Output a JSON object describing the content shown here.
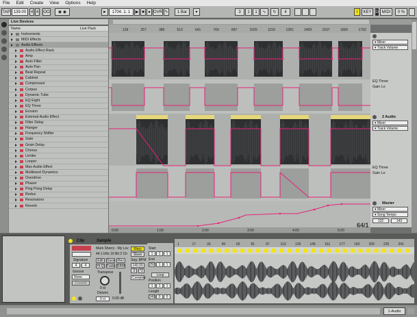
{
  "menu": {
    "file": "File",
    "edit": "Edit",
    "create": "Create",
    "view": "View",
    "options": "Options",
    "help": "Help"
  },
  "transport": {
    "tap": "TAP",
    "tempo": "139.00",
    "sig_num": "4",
    "sig_den": "4",
    "oo": "OO",
    "position": "1704. 1. 1",
    "ovr": "OVR",
    "quantize": "1 Bar",
    "loop_start": "3",
    "loop_beat": "1",
    "loop_sixteenth": "1",
    "punch_len": "4",
    "key": "KEY",
    "midi": "MIDI",
    "cpu": "0 %",
    "key_letter": "I",
    "key_indicator": "D"
  },
  "browser": {
    "header_left": "Live Devices",
    "header_right": "Live Pack",
    "name_col": "Name",
    "items": [
      "Instruments",
      "MIDI Effects",
      "Audio Effects",
      "Audio Effect Rack",
      "Amp",
      "Auto Filter",
      "Auto Pan",
      "Beat Repeat",
      "Cabinet",
      "Compressor",
      "Corpus",
      "Dynamic Tube",
      "EQ Eight",
      "EQ Three",
      "Erosion",
      "External Audio Effect",
      "Filter Delay",
      "Flanger",
      "Frequency Shifter",
      "Gate",
      "Grain Delay",
      "Chorus",
      "Limiter",
      "Looper",
      "Max Audio Effect",
      "Multiband Dynamics",
      "Overdrive",
      "Phaser",
      "Ping Pong Delay",
      "Redux",
      "Resonators",
      "Reverb"
    ]
  },
  "ruler": {
    "bars": [
      "129",
      "257",
      "385",
      "513",
      "641",
      "769",
      "897",
      "1025",
      "1153",
      "1281",
      "1409",
      "1537",
      "1665",
      "1793"
    ],
    "times": [
      "0:00",
      "1:00",
      "2:00",
      "3:00",
      "4:00",
      "5:00"
    ],
    "zoom": "64/1"
  },
  "tracks": [
    {
      "name": "",
      "device": "Mixer",
      "param": "Track Volume",
      "auto_label": "EQ Three",
      "auto_sub": "Gain Lo",
      "number": "1"
    },
    {
      "name": "2 Audio",
      "device": "Mixer",
      "param": "Track Volume",
      "auto_label": "EQ Three",
      "auto_sub": "Gain Lo",
      "number": "2"
    },
    {
      "name": "Master",
      "device": "Mixer",
      "param": "Song Tempo",
      "min": "132",
      "max": "143"
    }
  ],
  "clip": {
    "title": "Clip",
    "signature_label": "Signature",
    "sig_num": "4",
    "sig_den": "4",
    "groove_label": "Groove",
    "groove": "None",
    "commit": "Commit",
    "sample_title": "Sample",
    "sample_name": "Mark Sherry - My Lov",
    "sample_info": "44.1 kHz 16 Bit 2 Ch",
    "edit": "Edit",
    "save": "Save",
    "rev": "Rev",
    "hiq": "Hi-Q",
    "fade": "Fade",
    "ram": "RAM",
    "warp": "Warp",
    "slave": "Slave",
    "seg_bpm_label": "Seg. BPM",
    "seg_bpm": "140.00",
    "half": ":2",
    "double": "*2",
    "complex": "Complex",
    "start_label": "Start",
    "start_val": "1",
    "start_b": "1",
    "start_c": "1",
    "end_label": "End",
    "end_val": "250",
    "end_b": "1",
    "end_c": "1",
    "loop": "Loop",
    "position_label": "Position",
    "pos_val": "1",
    "pos_b": "1",
    "pos_c": "1",
    "length_label": "Length",
    "len_val": "249",
    "len_b": "0",
    "len_c": "0",
    "transpose_label": "Transpose",
    "transpose_val": "0 st",
    "detune_label": "Detune",
    "detune_val": "0 ct",
    "gain_val": "0.00 dB",
    "ruler": [
      "1",
      "17",
      "33",
      "49",
      "65",
      "81",
      "97",
      "113",
      "129",
      "145",
      "161",
      "177",
      "193",
      "209",
      "225",
      "241"
    ]
  },
  "status": {
    "track": "1-Audio"
  },
  "colors": {
    "accent": "#e8207a",
    "clip": "#c8373f",
    "yellow": "#f2e41a"
  }
}
